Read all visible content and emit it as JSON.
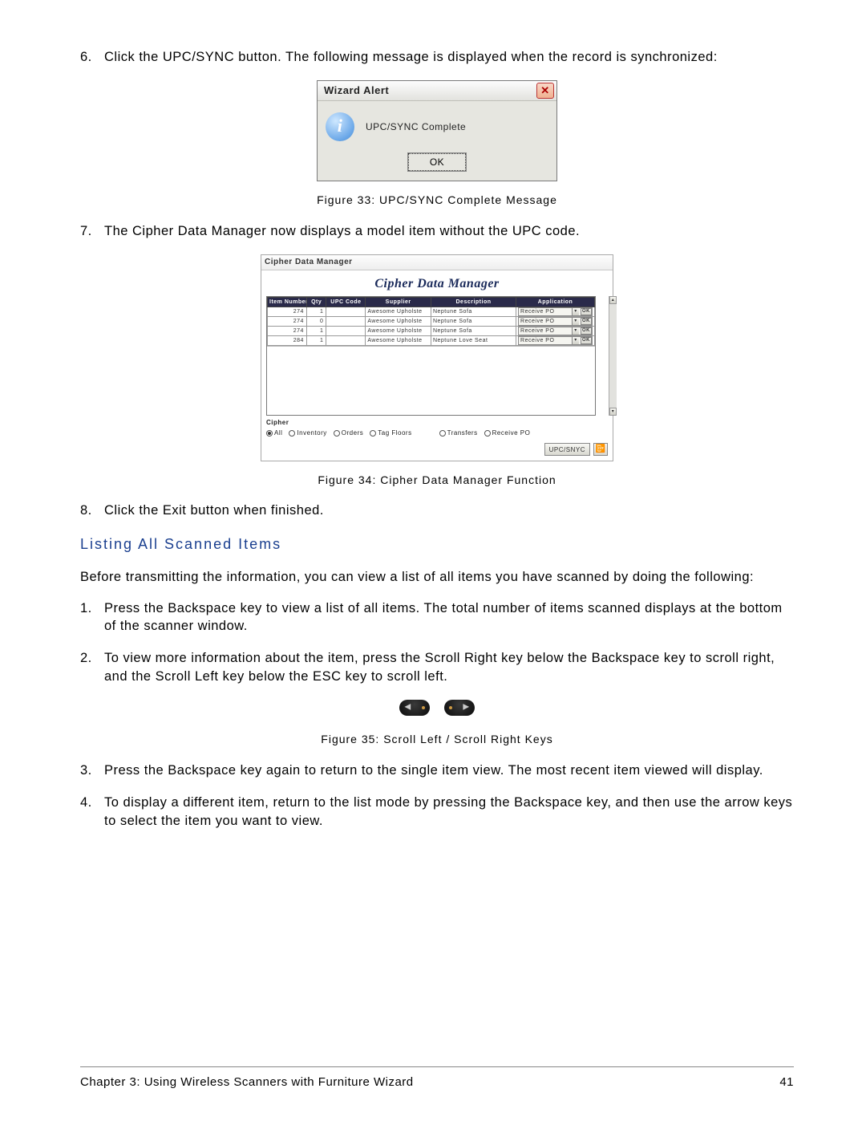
{
  "steps": {
    "s6_num": "6.",
    "s6": "Click the UPC/SYNC button. The following message is displayed when the record is synchronized:",
    "s7_num": "7.",
    "s7": "The Cipher Data Manager now displays a model item without the UPC code.",
    "s8_num": "8.",
    "s8": "Click the Exit button when finished."
  },
  "alert": {
    "title": "Wizard Alert",
    "message": "UPC/SYNC Complete",
    "ok": "OK",
    "close_glyph": "✕"
  },
  "captions": {
    "fig33": "Figure 33: UPC/SYNC Complete Message",
    "fig34": "Figure 34: Cipher Data Manager Function",
    "fig35": "Figure 35: Scroll Left / Scroll Right Keys"
  },
  "cdm": {
    "win_title": "Cipher Data Manager",
    "header": "Cipher Data Manager",
    "columns": {
      "item_number": "Item Number",
      "qty": "Qty",
      "upc": "UPC Code",
      "supplier": "Supplier",
      "description": "Description",
      "application": "Application"
    },
    "rows": [
      {
        "item": "274",
        "qty": "1",
        "upc": "",
        "supplier": "Awesome Upholste",
        "desc": "Neptune Sofa",
        "app": "Receive PO",
        "ok": "OK"
      },
      {
        "item": "274",
        "qty": "0",
        "upc": "",
        "supplier": "Awesome Upholste",
        "desc": "Neptune Sofa",
        "app": "Receive PO",
        "ok": "OK"
      },
      {
        "item": "274",
        "qty": "1",
        "upc": "",
        "supplier": "Awesome Upholste",
        "desc": "Neptune Sofa",
        "app": "Receive PO",
        "ok": "OK"
      },
      {
        "item": "284",
        "qty": "1",
        "upc": "",
        "supplier": "Awesome Upholste",
        "desc": "Neptune Love Seat",
        "app": "Receive PO",
        "ok": "OK"
      }
    ],
    "group_label": "Cipher",
    "radios": {
      "all": "All",
      "inventory": "Inventory",
      "orders": "Orders",
      "tag_floors": "Tag Floors",
      "transfers": "Transfers",
      "receive_po": "Receive PO"
    },
    "upcsync_btn": "UPC/SNYC",
    "exit_glyph": "📴",
    "dd_glyph": "▾",
    "scroll_up": "▴",
    "scroll_down": "▾"
  },
  "section2": {
    "heading": "Listing All Scanned Items",
    "intro": "Before transmitting the information, you can view a list of all items you have scanned by doing the following:",
    "s1_num": "1.",
    "s1": "Press the Backspace key to view a list of all items. The total number of items scanned displays at the bottom of the scanner window.",
    "s2_num": "2.",
    "s2": "To view more information about the item, press the Scroll Right key below the Backspace key to scroll right, and the Scroll Left key below the ESC key to scroll left.",
    "s3_num": "3.",
    "s3": "Press the Backspace key again to return to the single item view. The most recent item viewed will display.",
    "s4_num": "4.",
    "s4": "To display a different item, return to the list mode by pressing the Backspace key, and then use the arrow keys to select the item you want to view."
  },
  "keys": {
    "left_arrow": "◀",
    "right_arrow": "▶"
  },
  "footer": {
    "chapter": "Chapter 3: Using Wireless Scanners with Furniture Wizard",
    "page": "41"
  }
}
